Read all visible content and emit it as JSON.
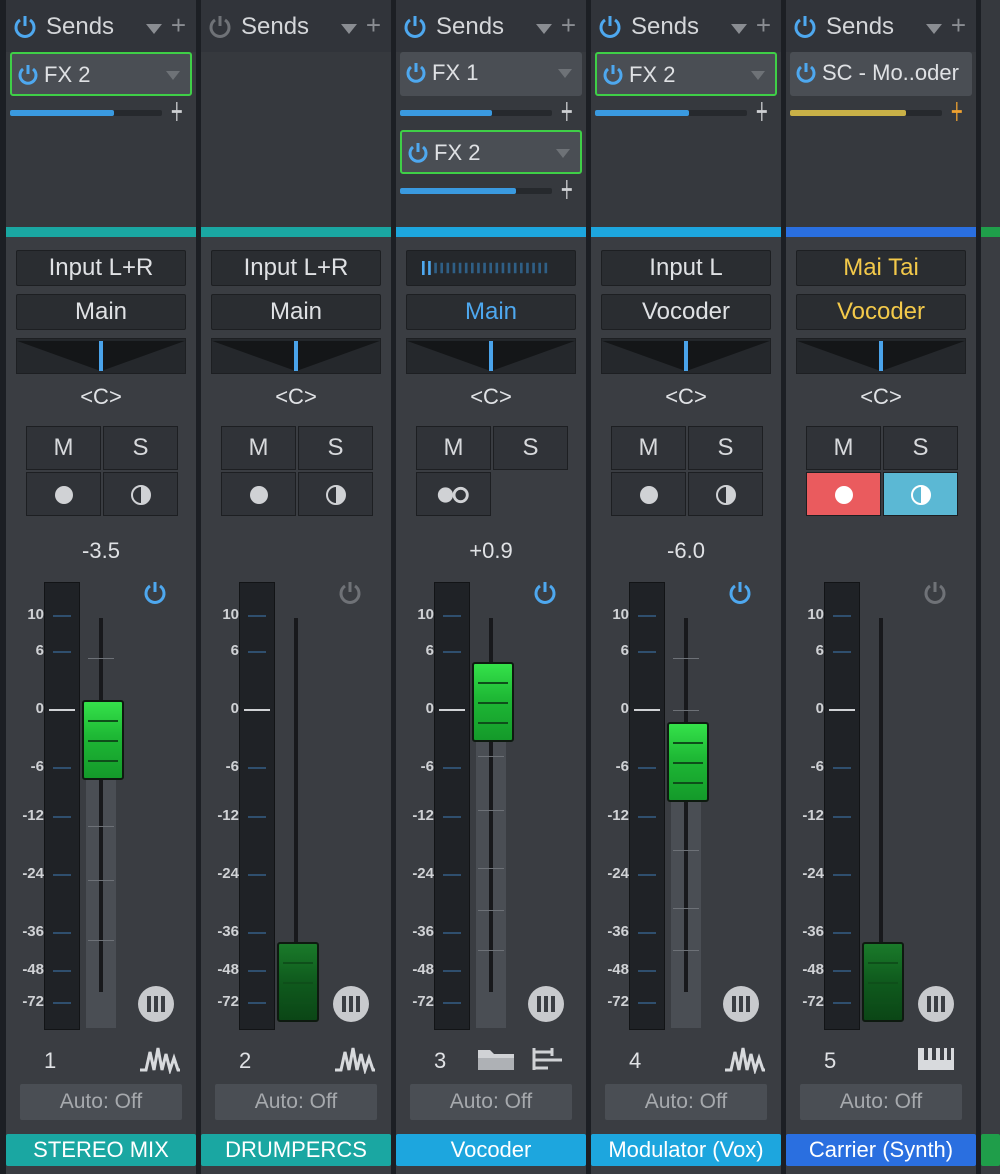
{
  "colors": {
    "blue_power": "#4ea8ef",
    "grey_power": "#6f7277",
    "fader_green": "#20c23a",
    "mute_red": "#ea5b5e",
    "solo_blue": "#5bb8d4",
    "yellow_label": "#f3c94a"
  },
  "channels": [
    {
      "sends_label": "Sends",
      "sends_power": "on",
      "send_slots": [
        {
          "label": "FX 2",
          "level_fraction": 0.68,
          "selected": true
        }
      ],
      "input": "Input L+R",
      "output": "Main",
      "pan": "<C>",
      "mute": "M",
      "solo": "S",
      "volume": "-3.5",
      "fader_power": "on",
      "scale": [
        "10",
        "6",
        "0",
        "-6",
        "-12",
        "-24",
        "-36",
        "-48",
        "-72"
      ],
      "number": "1",
      "type_icon": "waveform-icon",
      "automation": "Auto: Off",
      "name": "STEREO MIX",
      "color": "#1aa7a2"
    },
    {
      "sends_label": "Sends",
      "sends_power": "off",
      "send_slots": [],
      "input": "Input L+R",
      "output": "Main",
      "pan": "<C>",
      "mute": "M",
      "solo": "S",
      "volume": "",
      "fader_power": "off",
      "scale": [
        "10",
        "6",
        "0",
        "-6",
        "-12",
        "-24",
        "-36",
        "-48",
        "-72"
      ],
      "number": "2",
      "type_icon": "waveform-icon",
      "automation": "Auto: Off",
      "name": "DRUMPERCS",
      "color": "#1aa7a2"
    },
    {
      "sends_label": "Sends",
      "sends_power": "on",
      "send_slots": [
        {
          "label": "FX 1",
          "level_fraction": 0.6,
          "selected": false
        },
        {
          "label": "FX 2",
          "level_fraction": 0.72,
          "selected": true
        }
      ],
      "input": "",
      "output": "Main",
      "pan": "<C>",
      "mute": "M",
      "solo": "S",
      "volume": "+0.9",
      "fader_power": "on",
      "scale": [
        "10",
        "6",
        "0",
        "-6",
        "-12",
        "-24",
        "-36",
        "-48",
        "-72"
      ],
      "number": "3",
      "type_icon": "folder-icon",
      "automation": "Auto: Off",
      "name": "Vocoder",
      "color": "#1da6de"
    },
    {
      "sends_label": "Sends",
      "sends_power": "on",
      "send_slots": [
        {
          "label": "FX 2",
          "level_fraction": 0.62,
          "selected": true
        }
      ],
      "input": "Input L",
      "output": "Vocoder",
      "pan": "<C>",
      "mute": "M",
      "solo": "S",
      "volume": "-6.0",
      "fader_power": "on",
      "scale": [
        "10",
        "6",
        "0",
        "-6",
        "-12",
        "-24",
        "-36",
        "-48",
        "-72"
      ],
      "number": "4",
      "type_icon": "waveform-icon",
      "automation": "Auto: Off",
      "name": "Modulator (Vox)",
      "color": "#1da6de"
    },
    {
      "sends_label": "Sends",
      "sends_power": "on",
      "send_slots": [
        {
          "label": "SC - Mo..oder",
          "level_fraction": 0.76,
          "selected": false
        }
      ],
      "input": "Mai Tai",
      "output": "Vocoder",
      "pan": "<C>",
      "mute": "M",
      "solo": "S",
      "volume": "",
      "fader_power": "off",
      "scale": [
        "10",
        "6",
        "0",
        "-6",
        "-12",
        "-24",
        "-36",
        "-48",
        "-72"
      ],
      "number": "5",
      "type_icon": "keyboard-icon",
      "automation": "Auto: Off",
      "name": "Carrier (Synth)",
      "color": "#2a6fe0"
    }
  ]
}
